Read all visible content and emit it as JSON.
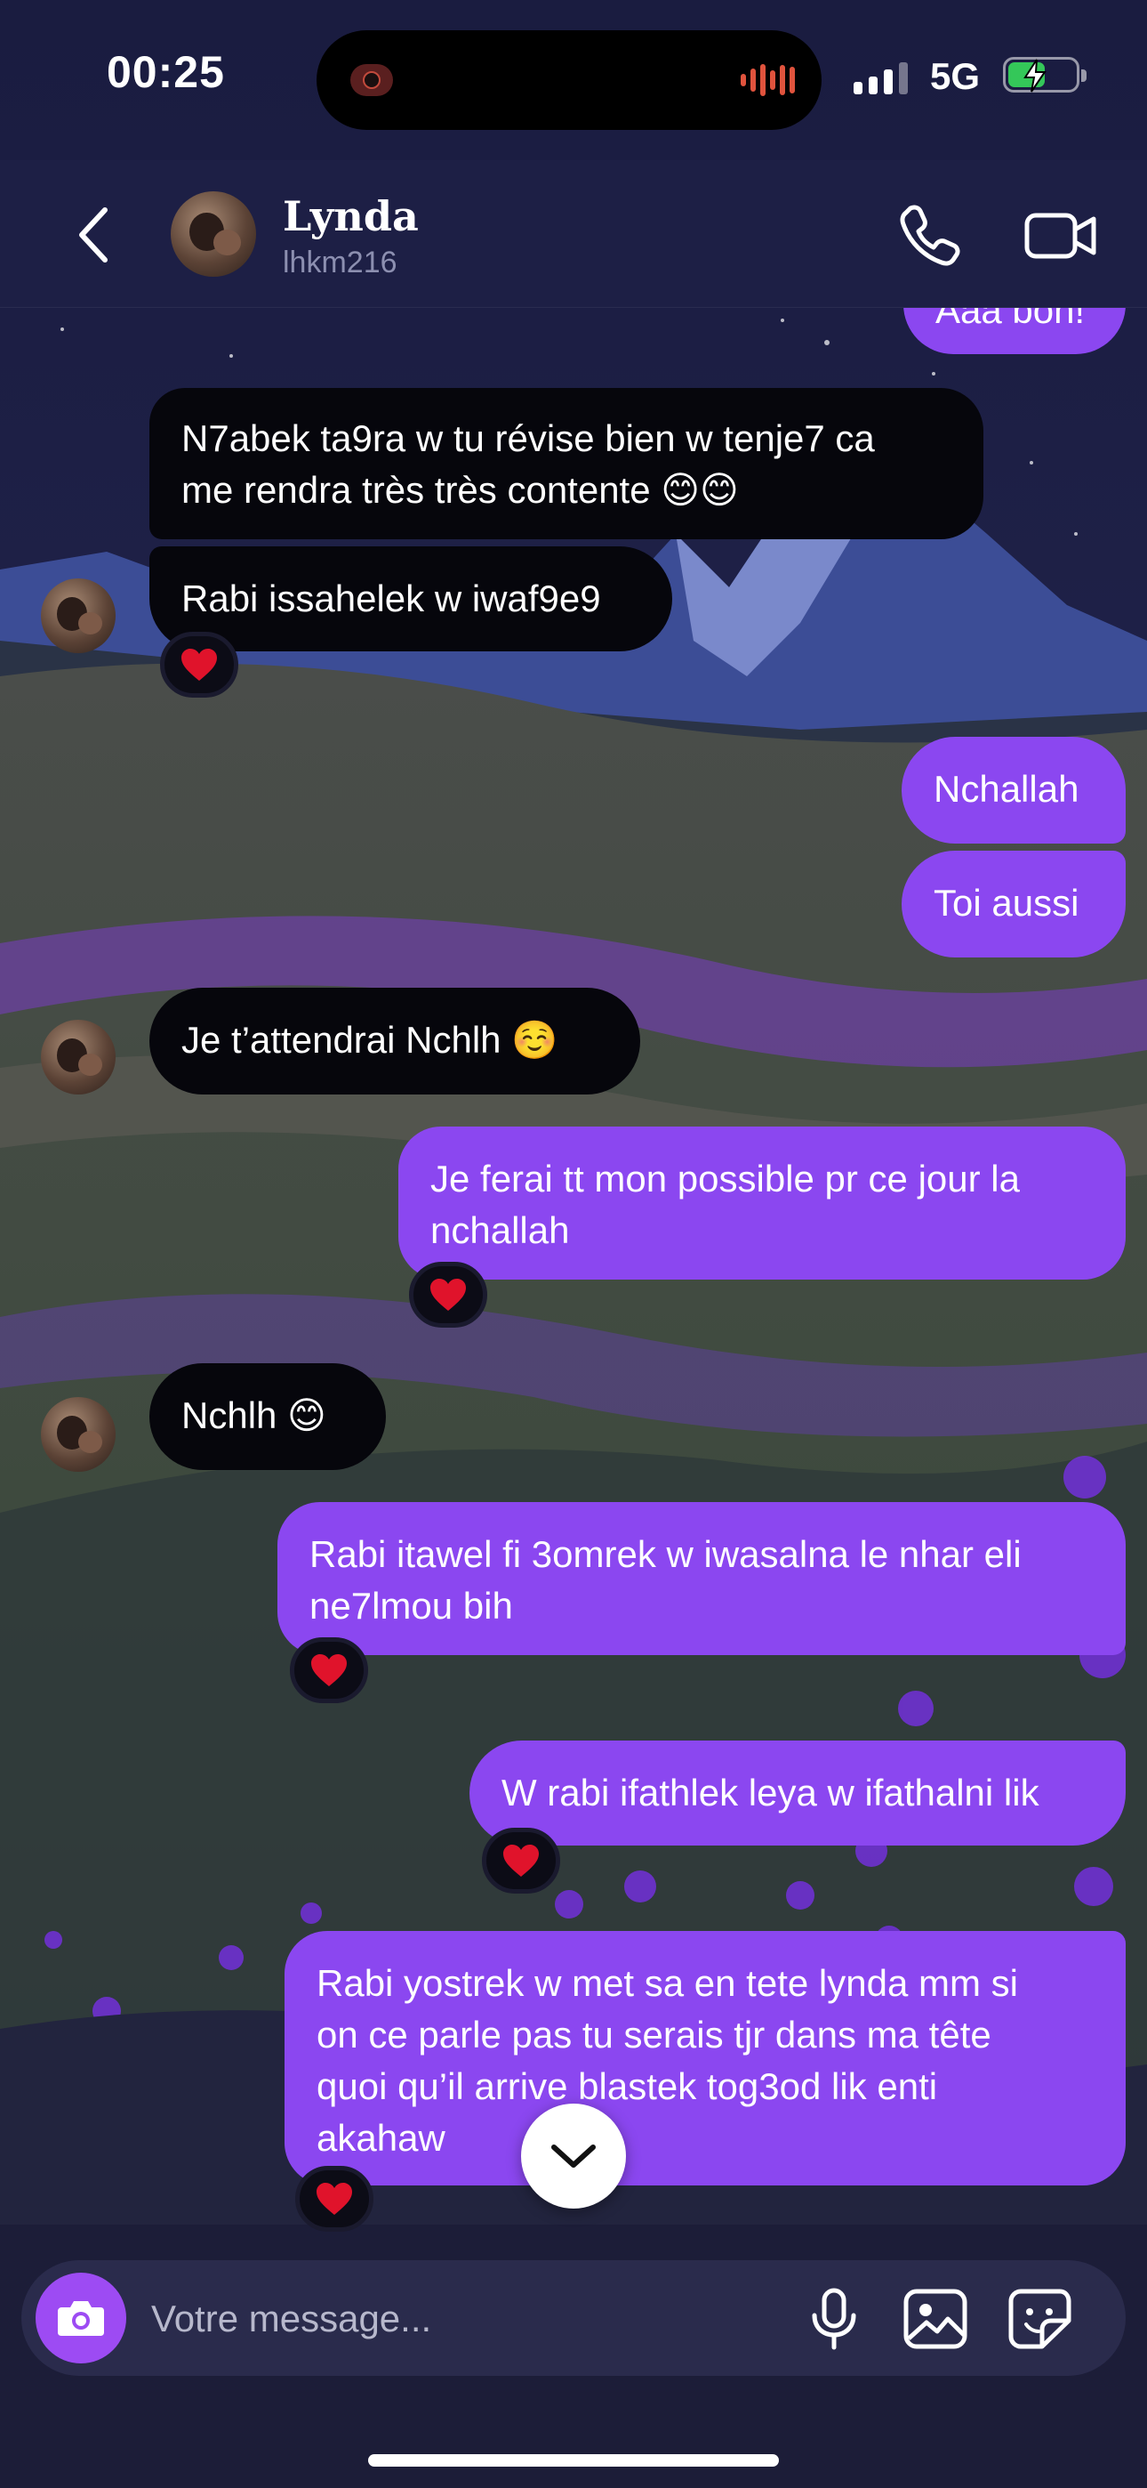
{
  "status_bar": {
    "time": "00:25",
    "network": "5G",
    "battery_level": 0.55,
    "battery_color": "#34c759"
  },
  "header": {
    "back_icon": "chevron-left-icon",
    "contact_name": "Lynda",
    "contact_handle": "lhkm216",
    "call_icon": "phone-icon",
    "video_icon": "video-camera-icon"
  },
  "conversation": {
    "partial_top_message": "Aaa bon!",
    "messages": [
      {
        "sender": "contact",
        "text": "N7abek ta9ra w tu révise bien w tenje7 ca\nme rendra très très contente 😊😊",
        "reaction": null
      },
      {
        "sender": "contact",
        "text": "Rabi issahelek w iwaf9e9",
        "reaction": "❤️"
      },
      {
        "sender": "me",
        "text": "Nchallah",
        "reaction": null
      },
      {
        "sender": "me",
        "text": "Toi aussi",
        "reaction": null
      },
      {
        "sender": "contact",
        "text": "Je t’attendrai Nchlh ☺️",
        "reaction": null
      },
      {
        "sender": "me",
        "text": "Je ferai tt mon possible pr ce jour la\nnchallah",
        "reaction": "❤️"
      },
      {
        "sender": "contact",
        "text": "Nchlh 😊",
        "reaction": null
      },
      {
        "sender": "me",
        "text": "Rabi itawel fi 3omrek w iwasalna le nhar eli\nne7lmou bih",
        "reaction": "❤️"
      },
      {
        "sender": "me",
        "text": "W rabi ifathlek leya w ifathalni lik",
        "reaction": "❤️"
      },
      {
        "sender": "me",
        "text": "Rabi yostrek w met sa en tete lynda mm si\non ce parle pas tu serais tjr dans ma tête\nquoi qu’il arrive blastek tog3od lik enti\nakahaw",
        "reaction": "❤️"
      }
    ]
  },
  "scroll_button_icon": "chevron-down-icon",
  "composer": {
    "camera_icon": "camera-icon",
    "placeholder": "Votre message...",
    "mic_icon": "microphone-icon",
    "gallery_icon": "image-icon",
    "sticker_icon": "sticker-icon"
  },
  "colors": {
    "incoming_bubble": "#06060c",
    "outgoing_bubble": "#8b47f0",
    "camera_button": "#9d4bf3",
    "header_bg": "#1d1f45"
  }
}
